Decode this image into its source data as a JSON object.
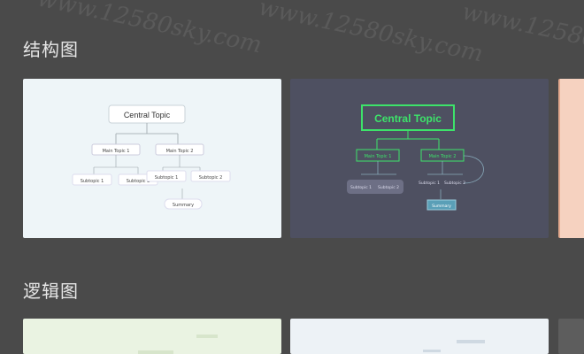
{
  "sections": [
    {
      "title": "结构图"
    },
    {
      "title": "逻辑图"
    }
  ],
  "light_card": {
    "central": "Central Topic",
    "main1": "Main Topic 1",
    "main2": "Main Topic 2",
    "sub1": "Subtopic 1",
    "sub2": "Subtopic 2",
    "sub3": "Subtopic 1",
    "sub4": "Subtopic 2",
    "summary": "Summary"
  },
  "dark_card": {
    "central": "Central Topic",
    "main1": "Main Topic 1",
    "main2": "Main Topic 2",
    "sub1": "Subtopic 1",
    "sub2": "Subtopic 2",
    "sub3": "Subtopic 1",
    "sub4": "Subtopic 2",
    "summary": "Summary"
  },
  "watermark": "www.12580sky.com",
  "colors": {
    "page_bg": "#4a4a4a",
    "light_card_bg": "#eef5f8",
    "dark_card_bg": "#4e5061",
    "dark_accent": "#3de36a",
    "peach_card": "#f6d2c0",
    "green_card": "#eaf3e2"
  }
}
